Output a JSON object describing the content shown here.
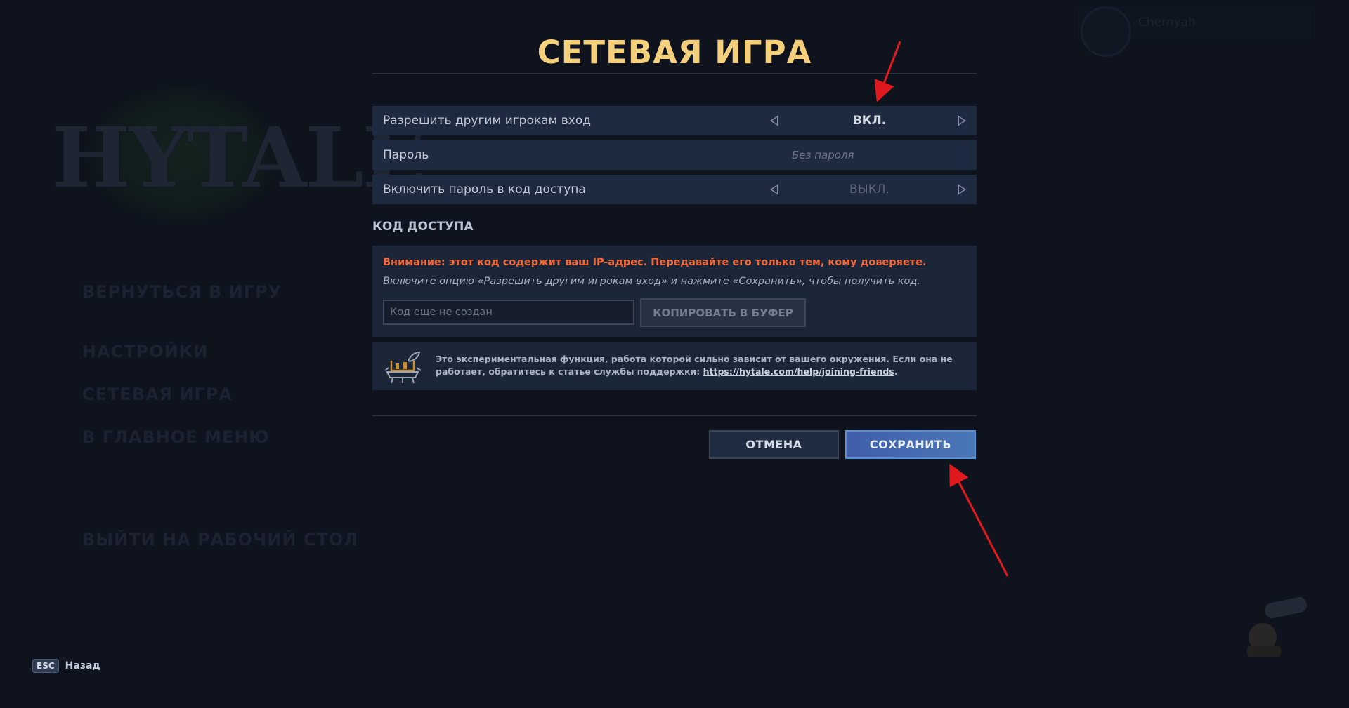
{
  "background": {
    "logo_text": "HYTALE",
    "menu_items": [
      "ВЕРНУТЬСЯ В ИГРУ",
      "НАСТРОЙКИ",
      "СЕТЕВАЯ ИГРА",
      "В ГЛАВНОЕ МЕНЮ",
      "ВЫЙТИ НА РАБОЧИЙ СТОЛ"
    ],
    "profile_name": "Chernyah"
  },
  "dialog": {
    "title": "СЕТЕВАЯ ИГРА",
    "settings": [
      {
        "label": "Разрешить другим игрокам вход",
        "value": "ВКЛ."
      },
      {
        "label": "Пароль",
        "placeholder": "Без пароля"
      },
      {
        "label": "Включить пароль в код доступа",
        "value": "ВЫКЛ."
      }
    ],
    "access_code": {
      "heading": "КОД ДОСТУПА",
      "warning": "Внимание: этот код содержит ваш IP-адрес. Передавайте его только тем, кому доверяете.",
      "hint": "Включите опцию «Разрешить другим игрокам вход» и нажмите «Сохранить», чтобы получить код.",
      "input_placeholder": "Код еще не создан",
      "copy_label": "КОПИРОВАТЬ В БУФЕР"
    },
    "info": {
      "text_before": "Это экспериментальная функция, работа которой сильно зависит от вашего окружения. Если она не работает, обратитесь к статье службы поддержки: ",
      "link": "https://hytale.com/help/joining-friends",
      "text_after": "."
    },
    "buttons": {
      "cancel": "ОТМЕНА",
      "save": "СОХРАНИТЬ"
    }
  },
  "footer": {
    "key": "ESC",
    "label": "Назад"
  },
  "colors": {
    "title": "#f4cf7c",
    "warning": "#f36a3a",
    "annotation_arrow": "#e0191f",
    "save_button": "#4a6db5"
  }
}
